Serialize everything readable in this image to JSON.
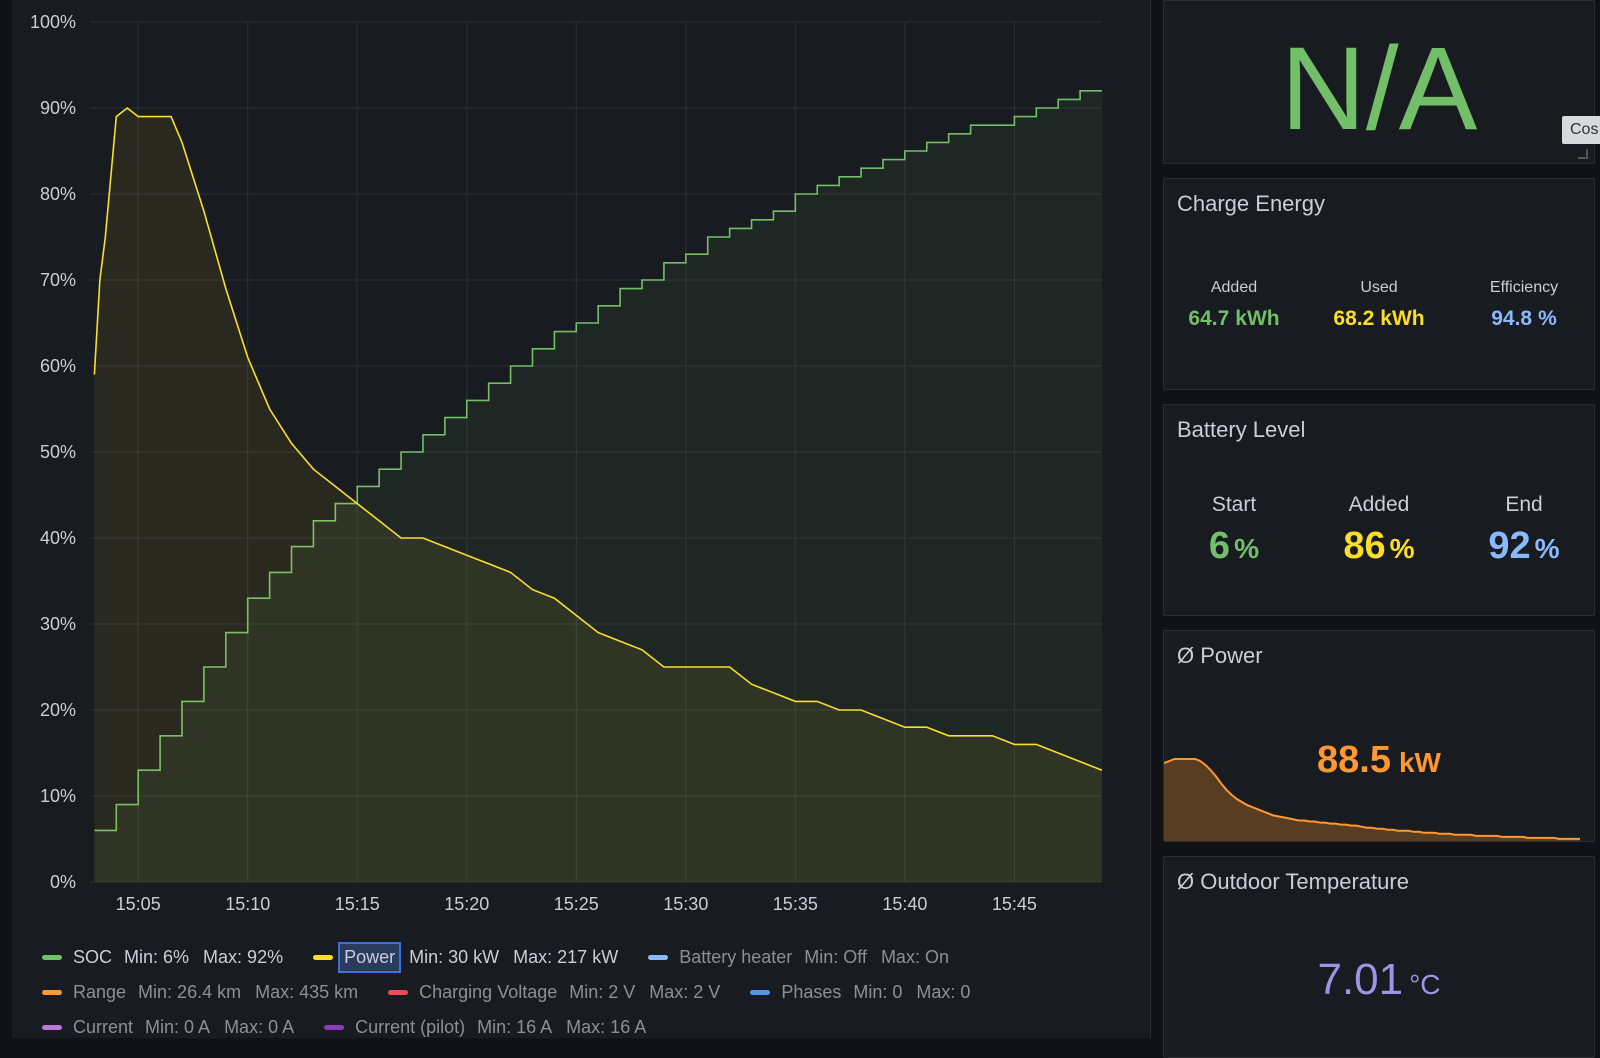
{
  "chart_data": {
    "type": "line",
    "title": "",
    "xlabel": "",
    "ylabel": "",
    "ylim": [
      0,
      100
    ],
    "y_ticks": [
      "0%",
      "10%",
      "20%",
      "30%",
      "40%",
      "50%",
      "60%",
      "70%",
      "80%",
      "90%",
      "100%"
    ],
    "x_ticks": [
      "15:05",
      "15:10",
      "15:15",
      "15:20",
      "15:25",
      "15:30",
      "15:35",
      "15:40",
      "15:45"
    ],
    "x_range": [
      "15:03",
      "15:49"
    ],
    "grid": true,
    "series": [
      {
        "name": "SOC",
        "color": "#73bf69",
        "x": [
          "15:03",
          "15:04",
          "15:05",
          "15:06",
          "15:07",
          "15:08",
          "15:09",
          "15:10",
          "15:11",
          "15:12",
          "15:13",
          "15:14",
          "15:15",
          "15:16",
          "15:17",
          "15:18",
          "15:19",
          "15:20",
          "15:21",
          "15:22",
          "15:23",
          "15:24",
          "15:25",
          "15:26",
          "15:27",
          "15:28",
          "15:29",
          "15:30",
          "15:31",
          "15:32",
          "15:33",
          "15:34",
          "15:35",
          "15:36",
          "15:37",
          "15:38",
          "15:39",
          "15:40",
          "15:41",
          "15:42",
          "15:43",
          "15:44",
          "15:45",
          "15:46",
          "15:47",
          "15:48",
          "15:49"
        ],
        "values": [
          6,
          9,
          13,
          17,
          21,
          25,
          29,
          33,
          36,
          39,
          42,
          44,
          46,
          48,
          50,
          52,
          54,
          56,
          58,
          60,
          62,
          64,
          65,
          67,
          69,
          70,
          72,
          73,
          75,
          76,
          77,
          78,
          80,
          81,
          82,
          83,
          84,
          85,
          86,
          87,
          88,
          88,
          89,
          90,
          91,
          92,
          92
        ]
      },
      {
        "name": "Power",
        "color": "#fade2a",
        "x": [
          "15:03",
          "15:03:15",
          "15:03:30",
          "15:04",
          "15:04:30",
          "15:05",
          "15:05:30",
          "15:06",
          "15:06:30",
          "15:07",
          "15:08",
          "15:09",
          "15:10",
          "15:11",
          "15:12",
          "15:13",
          "15:14",
          "15:15",
          "15:16",
          "15:17",
          "15:18",
          "15:19",
          "15:20",
          "15:21",
          "15:22",
          "15:23",
          "15:24",
          "15:25",
          "15:26",
          "15:27",
          "15:28",
          "15:29",
          "15:30",
          "15:31",
          "15:32",
          "15:33",
          "15:34",
          "15:35",
          "15:36",
          "15:37",
          "15:38",
          "15:39",
          "15:40",
          "15:41",
          "15:42",
          "15:43",
          "15:44",
          "15:45",
          "15:46",
          "15:47",
          "15:48",
          "15:49"
        ],
        "values": [
          59,
          70,
          75,
          89,
          90,
          89,
          89,
          89,
          89,
          86,
          78,
          69,
          61,
          55,
          51,
          48,
          46,
          44,
          42,
          40,
          40,
          39,
          38,
          37,
          36,
          34,
          33,
          31,
          29,
          28,
          27,
          25,
          25,
          25,
          25,
          23,
          22,
          21,
          21,
          20,
          20,
          19,
          18,
          18,
          17,
          17,
          17,
          16,
          16,
          15,
          14,
          13
        ]
      }
    ]
  },
  "legend": {
    "rows": [
      [
        {
          "name": "SOC",
          "color": "#73bf69",
          "min": "Min: 6%",
          "max": "Max: 92%",
          "dim": false,
          "boxed": false
        },
        {
          "name": "Power",
          "color": "#fade2a",
          "min": "Min: 30 kW",
          "max": "Max: 217 kW",
          "dim": false,
          "boxed": true
        },
        {
          "name": "Battery heater",
          "color": "#8ab8ff",
          "min": "Min: Off",
          "max": "Max: On",
          "dim": true,
          "boxed": false
        }
      ],
      [
        {
          "name": "Range",
          "color": "#ff9830",
          "min": "Min: 26.4 km",
          "max": "Max: 435 km",
          "dim": true,
          "boxed": false
        },
        {
          "name": "Charging Voltage",
          "color": "#f2495c",
          "min": "Min: 2 V",
          "max": "Max: 2 V",
          "dim": true,
          "boxed": false
        },
        {
          "name": "Phases",
          "color": "#5794f2",
          "min": "Min: 0",
          "max": "Max: 0",
          "dim": true,
          "boxed": false
        }
      ],
      [
        {
          "name": "Current",
          "color": "#b877d9",
          "min": "Min: 0 A",
          "max": "Max: 0 A",
          "dim": true,
          "boxed": false
        },
        {
          "name": "Current (pilot)",
          "color": "#8f3bb8",
          "min": "Min: 16 A",
          "max": "Max: 16 A",
          "dim": true,
          "boxed": false
        }
      ]
    ]
  },
  "cost_panel": {
    "value": "N/A",
    "tab_label": "Cos"
  },
  "charge_energy": {
    "title": "Charge Energy",
    "added": {
      "label": "Added",
      "value": "64.7",
      "unit": "kWh"
    },
    "used": {
      "label": "Used",
      "value": "68.2",
      "unit": "kWh"
    },
    "efficiency": {
      "label": "Efficiency",
      "value": "94.8",
      "unit": "%"
    }
  },
  "battery_level": {
    "title": "Battery Level",
    "start": {
      "label": "Start",
      "value": "6",
      "unit": "%"
    },
    "added": {
      "label": "Added",
      "value": "86",
      "unit": "%"
    },
    "end": {
      "label": "End",
      "value": "92",
      "unit": "%"
    }
  },
  "avg_power": {
    "title": "Ø Power",
    "value": "88.5",
    "unit": "kW",
    "sparkline": [
      76,
      78,
      80,
      80,
      80,
      80,
      80,
      78,
      74,
      69,
      63,
      56,
      50,
      45,
      41,
      38,
      35,
      33,
      31,
      29,
      27,
      25,
      24,
      23,
      22,
      21,
      20,
      20,
      19,
      19,
      18,
      18,
      17,
      17,
      16,
      16,
      15,
      15,
      14,
      13,
      13,
      12,
      12,
      11,
      11,
      10,
      10,
      10,
      9,
      9,
      8,
      8,
      8,
      7,
      7,
      7,
      6,
      6,
      6,
      6,
      5,
      5,
      5,
      5,
      5,
      4,
      4,
      4,
      4,
      4,
      3,
      3,
      3,
      3,
      3,
      3,
      2,
      2,
      2,
      2,
      2
    ]
  },
  "outdoor_temp": {
    "title": "Ø Outdoor Temperature",
    "value": "7.01",
    "unit": "°C"
  }
}
